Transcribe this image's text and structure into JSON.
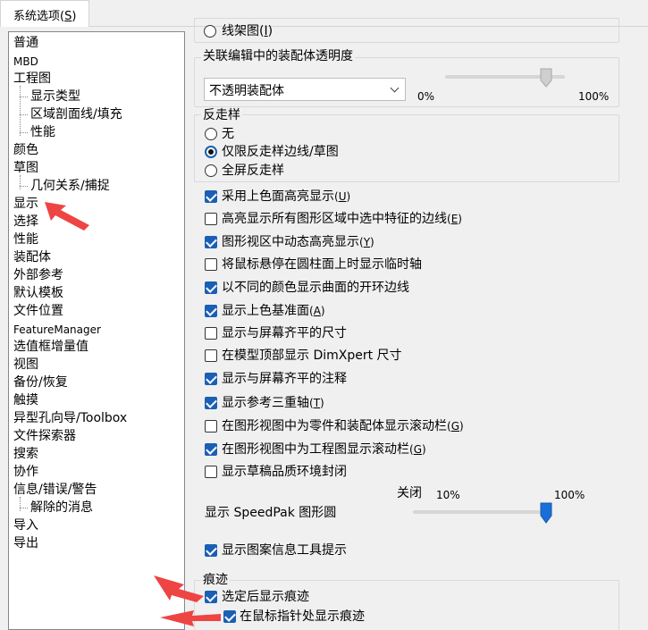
{
  "tab": {
    "label": "系统选项",
    "mnemonic": "S"
  },
  "tree": {
    "items": [
      {
        "label": "普通",
        "level": 0
      },
      {
        "label": "MBD",
        "level": 0,
        "small": true
      },
      {
        "label": "工程图",
        "level": 0
      },
      {
        "label": "显示类型",
        "level": 1
      },
      {
        "label": "区域剖面线/填充",
        "level": 1
      },
      {
        "label": "性能",
        "level": 1
      },
      {
        "label": "颜色",
        "level": 0
      },
      {
        "label": "草图",
        "level": 0
      },
      {
        "label": "几何关系/捕捉",
        "level": 1
      },
      {
        "label": "显示",
        "level": 0,
        "selected": true
      },
      {
        "label": "选择",
        "level": 0
      },
      {
        "label": "性能",
        "level": 0
      },
      {
        "label": "装配体",
        "level": 0
      },
      {
        "label": "外部参考",
        "level": 0
      },
      {
        "label": "默认模板",
        "level": 0
      },
      {
        "label": "文件位置",
        "level": 0
      },
      {
        "label": "FeatureManager",
        "level": 0,
        "small": true
      },
      {
        "label": "选值框增量值",
        "level": 0
      },
      {
        "label": "视图",
        "level": 0
      },
      {
        "label": "备份/恢复",
        "level": 0
      },
      {
        "label": "触摸",
        "level": 0
      },
      {
        "label": "异型孔向导/Toolbox",
        "level": 0
      },
      {
        "label": "文件探索器",
        "level": 0
      },
      {
        "label": "搜索",
        "level": 0
      },
      {
        "label": "协作",
        "level": 0
      },
      {
        "label": "信息/错误/警告",
        "level": 0
      },
      {
        "label": "解除的消息",
        "level": 1
      },
      {
        "label": "导入",
        "level": 0
      },
      {
        "label": "导出",
        "level": 0
      }
    ]
  },
  "top_partial": {
    "label": "线架图",
    "mnemonic": "I"
  },
  "transparency": {
    "title": "关联编辑中的装配体透明度",
    "dropdown_value": "不透明装配体",
    "min_label": "0%",
    "max_label": "100%",
    "level_percent": 100
  },
  "antialias": {
    "title": "反走样",
    "options": [
      {
        "label": "无",
        "selected": false
      },
      {
        "label": "仅限反走样边线/草图",
        "selected": true
      },
      {
        "label": "全屏反走样",
        "selected": false
      }
    ]
  },
  "checks": [
    {
      "label": "采用上色面高亮显示",
      "mnemonic": "U",
      "checked": true
    },
    {
      "label": "高亮显示所有图形区域中选中特征的边线",
      "mnemonic": "E",
      "checked": false
    },
    {
      "label": "图形视区中动态高亮显示",
      "mnemonic": "Y",
      "checked": true
    },
    {
      "label": "将鼠标悬停在圆柱面上时显示临时轴",
      "mnemonic": "",
      "checked": false
    },
    {
      "label": "以不同的颜色显示曲面的开环边线",
      "mnemonic": "",
      "checked": true
    },
    {
      "label": "显示上色基准面",
      "mnemonic": "A",
      "checked": true
    },
    {
      "label": "显示与屏幕齐平的尺寸",
      "mnemonic": "",
      "checked": false
    },
    {
      "label": "在模型顶部显示 DimXpert 尺寸",
      "mnemonic": "",
      "checked": false
    },
    {
      "label": "显示与屏幕齐平的注释",
      "mnemonic": "",
      "checked": true
    },
    {
      "label": "显示参考三重轴",
      "mnemonic": "T",
      "checked": true
    },
    {
      "label": "在图形视图中为零件和装配体显示滚动栏",
      "mnemonic": "G",
      "checked": false
    },
    {
      "label": "在图形视图中为工程图显示滚动栏",
      "mnemonic": "G",
      "checked": true
    },
    {
      "label": "显示草稿品质环境封闭",
      "mnemonic": "",
      "checked": false
    }
  ],
  "speedpak": {
    "label": "显示 SpeedPak 图形圆",
    "off_label": "关闭",
    "min_label": "10%",
    "max_label": "100%",
    "level_percent": 100
  },
  "pattern_tooltip": {
    "label": "显示图案信息工具提示",
    "checked": true
  },
  "trace": {
    "title": "痕迹",
    "items": [
      {
        "label": "选定后显示痕迹",
        "checked": true
      },
      {
        "label": "在鼠标指针处显示痕迹",
        "checked": true
      }
    ]
  },
  "colors": {
    "accent": "#1a5fb4",
    "annotation_arrow": "#ef4444"
  }
}
